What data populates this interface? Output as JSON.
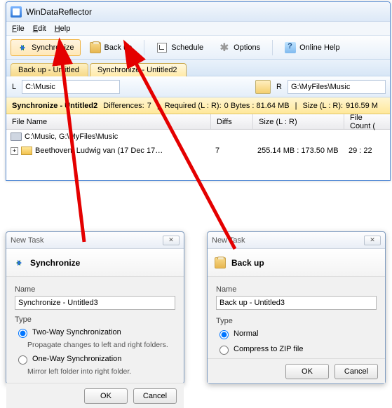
{
  "window": {
    "title": "WinDataReflector"
  },
  "menu": {
    "file": "File",
    "edit": "Edit",
    "help": "Help"
  },
  "toolbar": {
    "sync": "Synchronize",
    "backup": "Back up",
    "schedule": "Schedule",
    "options": "Options",
    "help": "Online Help"
  },
  "tabs": {
    "backup": "Back up - Untitled",
    "sync": "Synchronize - Untitled2"
  },
  "paths": {
    "l_label": "L",
    "l_value": "C:\\Music",
    "r_label": "R",
    "r_value": "G:\\MyFiles\\Music"
  },
  "status": {
    "name": "Synchronize - Untitled2",
    "diffs_label": "Differences:",
    "diffs_val": "7",
    "req_label": "Required (L : R):",
    "req_val": "0 Bytes : 81.64 MB",
    "size_label": "Size (L : R):",
    "size_val": "916.59 M"
  },
  "grid": {
    "h_filename": "File Name",
    "h_diffs": "Diffs",
    "h_size": "Size (L : R)",
    "h_filecount": "File Count (",
    "root": "C:\\Music, G:\\MyFiles\\Music",
    "row0": {
      "expander": "+",
      "name": "Beethoven, Ludwig van (17 Dec 17…",
      "diffs": "7",
      "size": "255.14 MB : 173.50 MB",
      "filecount": "29 : 22"
    }
  },
  "dlg_sync": {
    "title": "New Task",
    "header": "Synchronize",
    "name_label": "Name",
    "name_value": "Synchronize - Untitled3",
    "type_label": "Type",
    "opt1": "Two-Way Synchronization",
    "opt1_desc": "Propagate changes to left and right folders.",
    "opt2": "One-Way Synchronization",
    "opt2_desc": "Mirror left folder into right folder.",
    "ok": "OK",
    "cancel": "Cancel"
  },
  "dlg_backup": {
    "title": "New Task",
    "header": "Back up",
    "name_label": "Name",
    "name_value": "Back up - Untitled3",
    "type_label": "Type",
    "opt1": "Normal",
    "opt2": "Compress to ZIP file",
    "ok": "OK",
    "cancel": "Cancel"
  }
}
